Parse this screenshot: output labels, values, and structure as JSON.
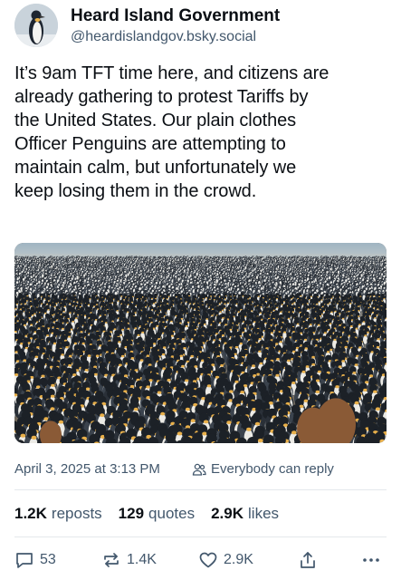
{
  "post": {
    "author": {
      "display_name": "Heard Island Government",
      "handle": "@heardislandgov.bsky.social",
      "avatar_icon": "penguin-avatar"
    },
    "text": "It’s 9am TFT time here, and citizens are already gathering to protest Tariffs by the United States. Our plain clothes Officer Penguins are attempting to maintain calm, but unfortunately we keep losing them in the crowd.",
    "text_lines": [
      "It’s 9am TFT time here, and citizens are",
      "already gathering to protest Tariffs by",
      "the United States. Our plain clothes",
      "Officer Penguins are attempting to",
      "maintain calm, but unfortunately we",
      "keep losing them in the crowd."
    ],
    "timestamp": "April 3, 2025 at 3:13 PM",
    "reply_setting": "Everybody can reply",
    "stats": {
      "reposts_count": "1.2K",
      "reposts_label": "reposts",
      "quotes_count": "129",
      "quotes_label": "quotes",
      "likes_count": "2.9K",
      "likes_label": "likes"
    },
    "actions": {
      "reply_count": "53",
      "repost_count": "1.4K",
      "like_count": "2.9K",
      "icons": [
        "reply-icon",
        "repost-icon",
        "like-icon",
        "share-icon",
        "more-icon"
      ]
    }
  },
  "colors": {
    "text_primary": "#0b0f14",
    "text_secondary": "#42576c",
    "divider": "#e4e8ec"
  }
}
